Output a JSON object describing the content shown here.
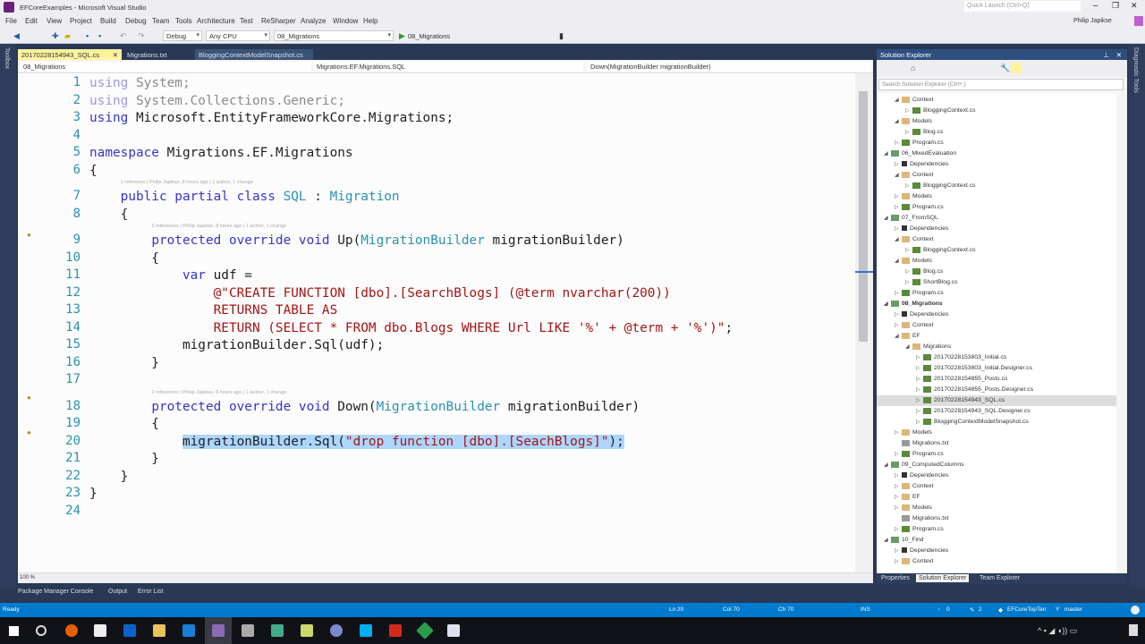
{
  "window": {
    "title": "EFCoreExamples - Microsoft Visual Studio",
    "quick_launch_placeholder": "Quick Launch (Ctrl+Q)",
    "user": "Philip Japikse"
  },
  "menu": [
    "File",
    "Edit",
    "View",
    "Project",
    "Build",
    "Debug",
    "Team",
    "Tools",
    "Architecture",
    "Test",
    "ReSharper",
    "Analyze",
    "Window",
    "Help"
  ],
  "toolbar": {
    "configuration": "Debug",
    "platform": "Any CPU",
    "startup_project": "08_Migrations",
    "run_label": "08_Migrations"
  },
  "left_strip": {
    "label": "Toolbox"
  },
  "right_strip": {
    "label": "Diagnostic Tools"
  },
  "tabs": [
    {
      "label": "20170228154943_SQL.cs",
      "active": true
    },
    {
      "label": "Migrations.txt"
    },
    {
      "label": "BloggingContextModelSnapshot.cs"
    }
  ],
  "navbar": {
    "project": "08_Migrations",
    "type": "Migrations.EF.Migrations.SQL",
    "member": "Down(MigrationBuilder migrationBuilder)"
  },
  "editor": {
    "zoom": "100 %",
    "codelens": {
      "7": "1 reference | Philip Japikse, 8 hours ago | 1 author, 1 change",
      "9": "2 references | Philip Japikse, 8 hours ago | 1 author, 1 change",
      "18": "2 references | Philip Japikse, 8 hours ago | 1 author, 1 change"
    },
    "lines": [
      [
        [
          "using",
          "dim"
        ],
        [
          " System;",
          "dimpl"
        ]
      ],
      [
        [
          "using",
          "dim"
        ],
        [
          " System.Collections.Generic;",
          "dimpl"
        ]
      ],
      [
        [
          "using",
          "kw"
        ],
        [
          " Microsoft.EntityFrameworkCore.Migrations;",
          "pl"
        ]
      ],
      [],
      [
        [
          "namespace",
          "kw"
        ],
        [
          " Migrations.EF.Migrations",
          "pl"
        ]
      ],
      [
        [
          "{",
          "pl"
        ]
      ],
      [
        [
          "    ",
          "pl"
        ],
        [
          "public partial class",
          "kw"
        ],
        [
          " ",
          "pl"
        ],
        [
          "SQL",
          "ty"
        ],
        [
          " : ",
          "pl"
        ],
        [
          "Migration",
          "ty"
        ]
      ],
      [
        [
          "    {",
          "pl"
        ]
      ],
      [
        [
          "        ",
          "pl"
        ],
        [
          "protected override void",
          "kw"
        ],
        [
          " Up(",
          "pl"
        ],
        [
          "MigrationBuilder",
          "ty"
        ],
        [
          " migrationBuilder)",
          "pl"
        ]
      ],
      [
        [
          "        {",
          "pl"
        ]
      ],
      [
        [
          "            ",
          "pl"
        ],
        [
          "var",
          "kw"
        ],
        [
          " udf =",
          "pl"
        ]
      ],
      [
        [
          "                ",
          "pl"
        ],
        [
          "@\"CREATE FUNCTION [dbo].[SearchBlogs] (@term nvarchar(200))",
          "st"
        ]
      ],
      [
        [
          "                ",
          "pl"
        ],
        [
          "RETURNS TABLE AS",
          "st"
        ]
      ],
      [
        [
          "                ",
          "pl"
        ],
        [
          "RETURN (SELECT * FROM dbo.Blogs WHERE Url LIKE '%' + @term + '%')\"",
          "st"
        ],
        [
          ";",
          "pl"
        ]
      ],
      [
        [
          "            migrationBuilder.Sql(udf);",
          "pl"
        ]
      ],
      [
        [
          "        }",
          "pl"
        ]
      ],
      [],
      [
        [
          "        ",
          "pl"
        ],
        [
          "protected override void",
          "kw"
        ],
        [
          " Down(",
          "pl"
        ],
        [
          "MigrationBuilder",
          "ty"
        ],
        [
          " migrationBuilder)",
          "pl"
        ]
      ],
      [
        [
          "        {",
          "pl"
        ]
      ],
      [
        [
          "            ",
          "pl"
        ],
        [
          "migrationBuilder.Sql(",
          "pl",
          "sel"
        ],
        [
          "\"drop function [dbo].[SeachBlogs]\"",
          "st",
          "sel"
        ],
        [
          ");",
          "pl",
          "sel"
        ]
      ],
      [
        [
          "        }",
          "pl"
        ]
      ],
      [
        [
          "    }",
          "pl"
        ]
      ],
      [
        [
          "}",
          "pl"
        ]
      ],
      []
    ]
  },
  "solution_explorer": {
    "title": "Solution Explorer",
    "search_placeholder": "Search Solution Explorer (Ctrl+;)",
    "tree": [
      {
        "label": "Context",
        "level": 2,
        "icon": "folder",
        "expanded": true
      },
      {
        "label": "BloggingContext.cs",
        "level": 3,
        "icon": "cs"
      },
      {
        "label": "Models",
        "level": 2,
        "icon": "folder",
        "expanded": true
      },
      {
        "label": "Blog.cs",
        "level": 3,
        "icon": "cs"
      },
      {
        "label": "Program.cs",
        "level": 2,
        "icon": "cs"
      },
      {
        "label": "06_MixedEvaluation",
        "level": 1,
        "icon": "project",
        "expanded": true
      },
      {
        "label": "Dependencies",
        "level": 2,
        "icon": "deps"
      },
      {
        "label": "Context",
        "level": 2,
        "icon": "folder",
        "expanded": true
      },
      {
        "label": "BloggingContext.cs",
        "level": 3,
        "icon": "cs"
      },
      {
        "label": "Models",
        "level": 2,
        "icon": "folder"
      },
      {
        "label": "Program.cs",
        "level": 2,
        "icon": "cs"
      },
      {
        "label": "07_FromSQL",
        "level": 1,
        "icon": "project",
        "expanded": true
      },
      {
        "label": "Dependencies",
        "level": 2,
        "icon": "deps"
      },
      {
        "label": "Context",
        "level": 2,
        "icon": "folder",
        "expanded": true
      },
      {
        "label": "BloggingContext.cs",
        "level": 3,
        "icon": "cs"
      },
      {
        "label": "Models",
        "level": 2,
        "icon": "folder",
        "expanded": true
      },
      {
        "label": "Blog.cs",
        "level": 3,
        "icon": "cs"
      },
      {
        "label": "ShortBlog.cs",
        "level": 3,
        "icon": "cs"
      },
      {
        "label": "Program.cs",
        "level": 2,
        "icon": "cs"
      },
      {
        "label": "08_Migrations",
        "level": 1,
        "icon": "project",
        "expanded": true,
        "bold": true
      },
      {
        "label": "Dependencies",
        "level": 2,
        "icon": "deps"
      },
      {
        "label": "Context",
        "level": 2,
        "icon": "folder"
      },
      {
        "label": "EF",
        "level": 2,
        "icon": "folder",
        "expanded": true
      },
      {
        "label": "Migrations",
        "level": 3,
        "icon": "folder",
        "expanded": true
      },
      {
        "label": "20170228153803_Initial.cs",
        "level": 4,
        "icon": "cs"
      },
      {
        "label": "20170228153803_Initial.Designer.cs",
        "level": 4,
        "icon": "cs"
      },
      {
        "label": "20170228154855_Posts.cs",
        "level": 4,
        "icon": "cs"
      },
      {
        "label": "20170228154855_Posts.Designer.cs",
        "level": 4,
        "icon": "cs"
      },
      {
        "label": "20170228154943_SQL.cs",
        "level": 4,
        "icon": "cs",
        "selected": true
      },
      {
        "label": "20170228154943_SQL.Designer.cs",
        "level": 4,
        "icon": "cs"
      },
      {
        "label": "BloggingContextModelSnapshot.cs",
        "level": 4,
        "icon": "cs"
      },
      {
        "label": "Models",
        "level": 2,
        "icon": "folder"
      },
      {
        "label": "Migrations.txt",
        "level": 2,
        "icon": "txt",
        "leaf": true
      },
      {
        "label": "Program.cs",
        "level": 2,
        "icon": "cs"
      },
      {
        "label": "09_ComputedColumns",
        "level": 1,
        "icon": "project",
        "expanded": true
      },
      {
        "label": "Dependencies",
        "level": 2,
        "icon": "deps"
      },
      {
        "label": "Context",
        "level": 2,
        "icon": "folder"
      },
      {
        "label": "EF",
        "level": 2,
        "icon": "folder"
      },
      {
        "label": "Models",
        "level": 2,
        "icon": "folder"
      },
      {
        "label": "Migrations.txt",
        "level": 2,
        "icon": "txt",
        "leaf": true
      },
      {
        "label": "Program.cs",
        "level": 2,
        "icon": "cs"
      },
      {
        "label": "10_Find",
        "level": 1,
        "icon": "project",
        "expanded": true
      },
      {
        "label": "Dependencies",
        "level": 2,
        "icon": "deps"
      },
      {
        "label": "Context",
        "level": 2,
        "icon": "folder"
      }
    ],
    "bottom_tabs": [
      {
        "label": "Properties"
      },
      {
        "label": "Solution Explorer",
        "active": true
      },
      {
        "label": "Team Explorer"
      }
    ]
  },
  "bottom_tool_tabs": [
    "Package Manager Console",
    "Output",
    "Error List"
  ],
  "status": {
    "ready": "Ready",
    "ln": "Ln 20",
    "col": "Col 70",
    "ch": "Ch 70",
    "mode": "INS",
    "push": "0",
    "changes": "2",
    "repo": "EFCoreTopTen",
    "branch": "master"
  },
  "colors": {
    "accent": "#007acc",
    "tab_active": "#fff29d",
    "chrome_dark": "#293955"
  }
}
